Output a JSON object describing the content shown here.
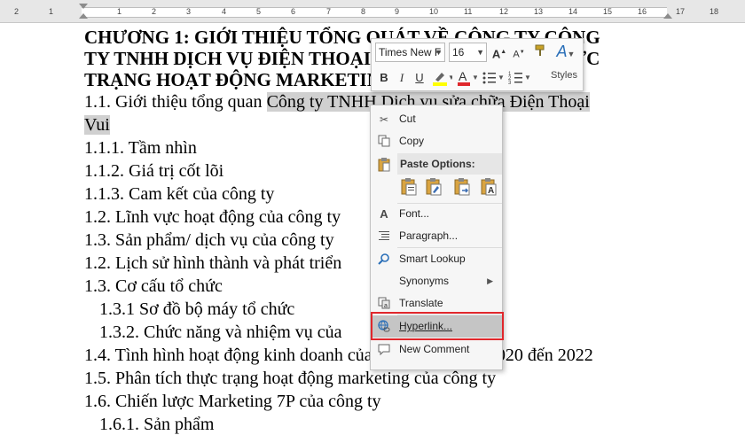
{
  "ruler": {
    "ticks": [
      "2",
      "1",
      "1",
      "2",
      "3",
      "4",
      "5",
      "6",
      "7",
      "8",
      "9",
      "10",
      "11",
      "12",
      "13",
      "14",
      "15",
      "16",
      "17",
      "18"
    ]
  },
  "document": {
    "heading": [
      "CHƯƠNG 1: GIỚI THIỆU TỔNG QUÁT VỀ CÔNG TY CÔNG",
      "TY TNHH DỊCH VỤ ĐIỆN THOẠI",
      "THỰC",
      "TRẠNG HOẠT ĐỘNG MARKETING"
    ],
    "lines": [
      {
        "pre": "1.1. Giới thiệu tổng quan ",
        "hl": "Công ty TNHH Dịch vụ sửa chữa Điện Thoại"
      },
      {
        "hl": "Vui"
      },
      {
        "text": "1.1.1. Tầm nhìn"
      },
      {
        "text": "1.1.2. Giá trị cốt lõi"
      },
      {
        "text": "1.1.3. Cam kết của công ty"
      },
      {
        "text": "1.2. Lĩnh vực hoạt động của công ty"
      },
      {
        "text": "1.3. Sản phẩm/ dịch vụ của công ty"
      },
      {
        "text": "1.2. Lịch sử hình thành và phát triển"
      },
      {
        "text": "1.3. Cơ cấu tổ chức"
      },
      {
        "text": "1.3.1 Sơ đồ bộ máy tổ chức",
        "sub": true
      },
      {
        "text": "1.3.2. Chức năng và nhiệm vụ của",
        "sub": true
      },
      {
        "text": "1.4. Tình hình hoạt động kinh doanh của công ty từ năm 2020 đến 2022"
      },
      {
        "text": "1.5. Phân tích thực trạng hoạt động marketing của công ty"
      },
      {
        "text": "1.6. Chiến lược Marketing 7P của công ty"
      },
      {
        "text": "1.6.1. Sản phẩm",
        "sub": true
      }
    ]
  },
  "mini_toolbar": {
    "font_name": "Times New F",
    "font_size": "16",
    "bold": "B",
    "italic": "I",
    "underline": "U",
    "styles_label": "Styles",
    "highlight_color": "#ffff00",
    "font_color": "#e0272c"
  },
  "context_menu": {
    "cut": "Cut",
    "copy": "Copy",
    "paste_options": "Paste Options:",
    "font": "Font...",
    "paragraph": "Paragraph...",
    "smart_lookup": "Smart Lookup",
    "synonyms": "Synonyms",
    "translate": "Translate",
    "hyperlink": "Hyperlink...",
    "new_comment": "New Comment"
  },
  "colors": {
    "selection_highlight": "#d0d0d0",
    "hover_item": "#c5c5c5",
    "red_outline": "#e0272c"
  }
}
